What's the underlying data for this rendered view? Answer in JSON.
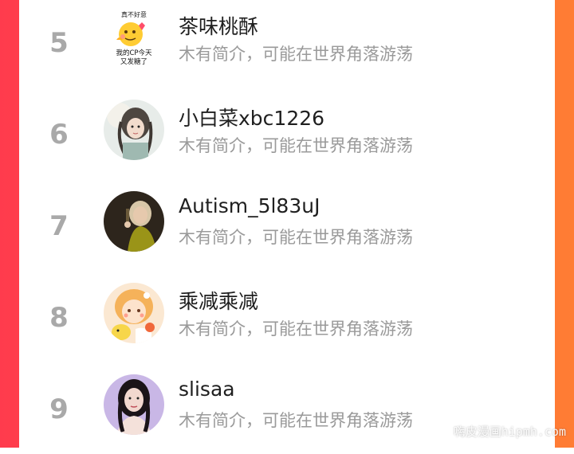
{
  "watermark": "嗨皮漫画hipmh.com",
  "colors": {
    "rank": "#a9a9a9",
    "name": "#1f1f1f",
    "bio": "#9a9a9a",
    "accent": "#ff5a40"
  },
  "users": [
    {
      "rank": "5",
      "name": "茶味桃酥",
      "bio": "木有简介，可能在世界角落游荡",
      "avatar": {
        "icon": "emoji-avatar-icon",
        "top_text": "真不好意",
        "mid_text": "我的CP今天",
        "bottom_text": "又发糖了"
      }
    },
    {
      "rank": "6",
      "name": "小白菜xbc1226",
      "bio": "木有简介，可能在世界角落游荡",
      "avatar": {
        "icon": "anime-portrait-avatar-icon"
      }
    },
    {
      "rank": "7",
      "name": "Autism_5l83uJ",
      "bio": "木有简介，可能在世界角落游荡",
      "avatar": {
        "icon": "photo-avatar-icon"
      }
    },
    {
      "rank": "8",
      "name": "乘减乘减",
      "bio": "木有简介，可能在世界角落游荡",
      "avatar": {
        "icon": "cartoon-girl-avatar-icon"
      }
    },
    {
      "rank": "9",
      "name": "slisaa",
      "bio": "木有简介，可能在世界角落游荡",
      "avatar": {
        "icon": "portrait-avatar-icon"
      }
    }
  ]
}
